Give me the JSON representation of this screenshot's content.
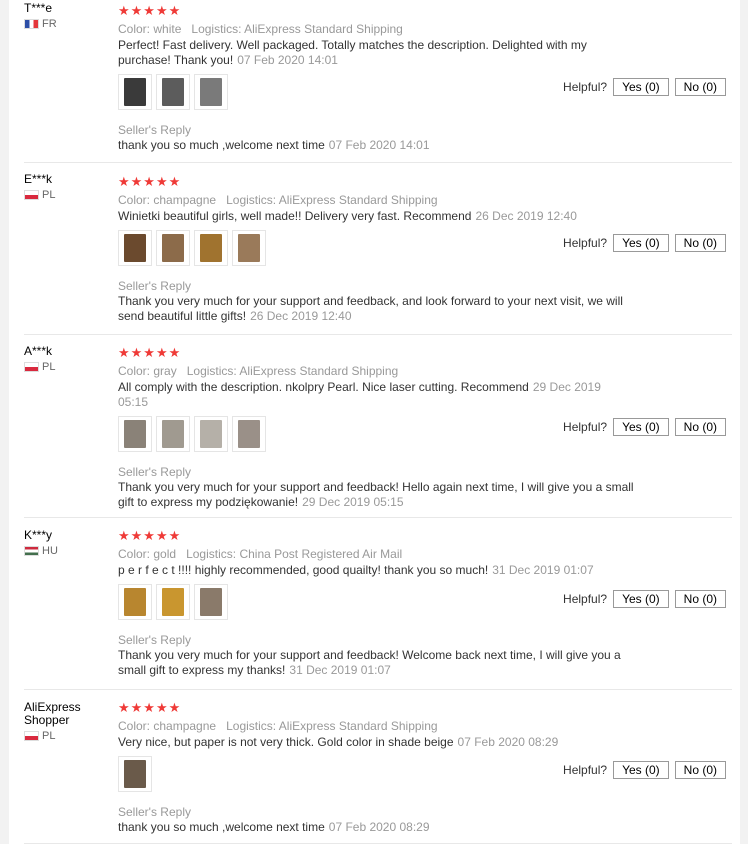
{
  "reviews": [
    {
      "name": "T***e",
      "country": "FR",
      "flag": "fr",
      "stars": "★★★★★",
      "color_label": "Color:",
      "color_value": "white",
      "logistics_label": "Logistics:",
      "logistics_value": "AliExpress Standard Shipping",
      "text": "Perfect! Fast delivery. Well packaged. Totally matches the description. Delighted with my purchase! Thank you!",
      "date": "07 Feb 2020 14:01",
      "thumbs": [
        "#3a3a3a",
        "#5c5c5c",
        "#7a7a7a"
      ],
      "reply_title": "Seller's Reply",
      "reply_text": "thank you so much ,welcome next time",
      "reply_date": "07 Feb 2020 14:01",
      "helpful_label": "Helpful?",
      "yes_label": "Yes (0)",
      "no_label": "No (0)"
    },
    {
      "name": "E***k",
      "country": "PL",
      "flag": "pl",
      "stars": "★★★★★",
      "color_label": "Color:",
      "color_value": "champagne",
      "logistics_label": "Logistics:",
      "logistics_value": "AliExpress Standard Shipping",
      "text": "Winietki beautiful girls, well made!! Delivery very fast. Recommend",
      "date": "26 Dec 2019 12:40",
      "thumbs": [
        "#6b4a2e",
        "#8c6b4a",
        "#a0732f",
        "#9a7a5a"
      ],
      "reply_title": "Seller's Reply",
      "reply_text": "Thank you very much for your support and feedback, and look forward to your next visit, we will send beautiful little gifts!",
      "reply_date": "26 Dec 2019 12:40",
      "helpful_label": "Helpful?",
      "yes_label": "Yes (0)",
      "no_label": "No (0)"
    },
    {
      "name": "A***k",
      "country": "PL",
      "flag": "pl",
      "stars": "★★★★★",
      "color_label": "Color:",
      "color_value": "gray",
      "logistics_label": "Logistics:",
      "logistics_value": "AliExpress Standard Shipping",
      "text": "All comply with the description. nkolpry Pearl. Nice laser cutting. Recommend",
      "date": "29 Dec 2019 05:15",
      "thumbs": [
        "#8a8278",
        "#a09a90",
        "#b5b0a8",
        "#9a9088"
      ],
      "reply_title": "Seller's Reply",
      "reply_text": "Thank you very much for your support and feedback! Hello again next time, I will give you a small gift to express my podziękowanie!",
      "reply_date": "29 Dec 2019 05:15",
      "helpful_label": "Helpful?",
      "yes_label": "Yes (0)",
      "no_label": "No (0)"
    },
    {
      "name": "K***y",
      "country": "HU",
      "flag": "hu",
      "stars": "★★★★★",
      "color_label": "Color:",
      "color_value": "gold",
      "logistics_label": "Logistics:",
      "logistics_value": "China Post Registered Air Mail",
      "text": "p e r f e c t !!!! highly recommended, good quailty! thank you so much!",
      "date": "31 Dec 2019 01:07",
      "thumbs": [
        "#b8862f",
        "#c9962f",
        "#8a7a6a"
      ],
      "reply_title": "Seller's Reply",
      "reply_text": "Thank you very much for your support and feedback! Welcome back next time, I will give you a small gift to express my thanks!",
      "reply_date": "31 Dec 2019 01:07",
      "helpful_label": "Helpful?",
      "yes_label": "Yes (0)",
      "no_label": "No (0)"
    },
    {
      "name": "AliExpress Shopper",
      "country": "PL",
      "flag": "pl",
      "stars": "★★★★★",
      "color_label": "Color:",
      "color_value": "champagne",
      "logistics_label": "Logistics:",
      "logistics_value": "AliExpress Standard Shipping",
      "text": "Very nice, but paper is not very thick. Gold color in shade beige",
      "date": "07 Feb 2020 08:29",
      "thumbs": [
        "#6a5a4a"
      ],
      "reply_title": "Seller's Reply",
      "reply_text": "thank you so much ,welcome next time",
      "reply_date": "07 Feb 2020 08:29",
      "helpful_label": "Helpful?",
      "yes_label": "Yes (0)",
      "no_label": "No (0)"
    }
  ]
}
